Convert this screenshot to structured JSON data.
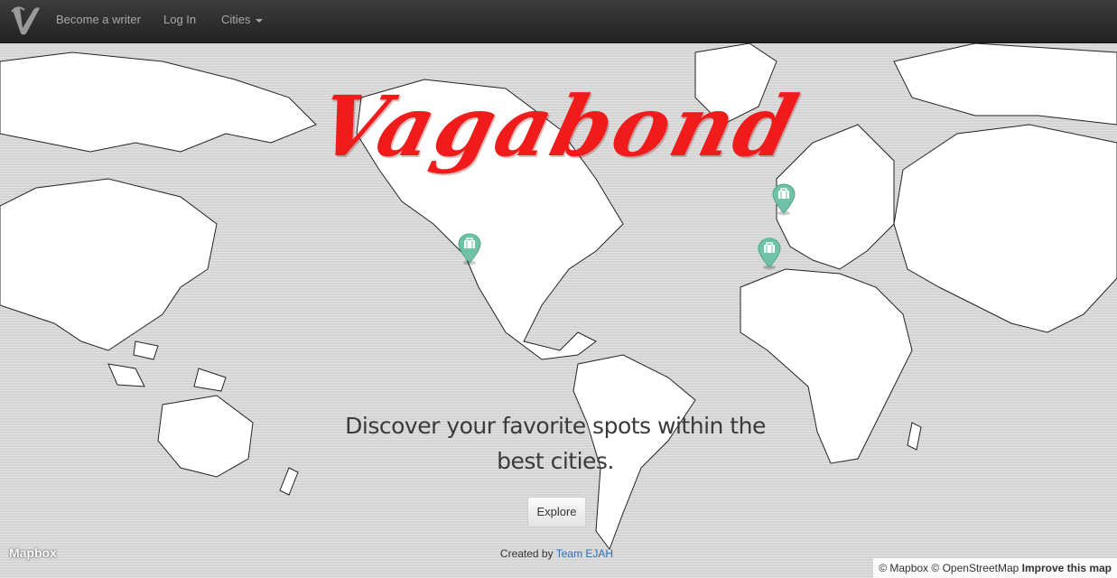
{
  "navbar": {
    "brand_icon": "v-logo-icon",
    "links": [
      "Become a writer",
      "Log In"
    ],
    "cities_label": "Cities"
  },
  "hero": {
    "title": "Vagabond",
    "tagline": "Discover your favorite spots within the best cities.",
    "explore_label": "Explore"
  },
  "footer": {
    "credit_prefix": "Created by",
    "credit_link": "Team EJAH"
  },
  "map": {
    "logo": "Mapbox",
    "attribution": {
      "mapbox": "© Mapbox",
      "osm": "© OpenStreetMap",
      "improve": "Improve this map"
    },
    "marker_icon": "suitcase-icon",
    "marker_color": "#6fc2a8",
    "marker_count": 3
  },
  "colors": {
    "title_red": "#f01c1c",
    "link_blue": "#2a6fb6",
    "nav_bg": "#2b2b2b"
  }
}
